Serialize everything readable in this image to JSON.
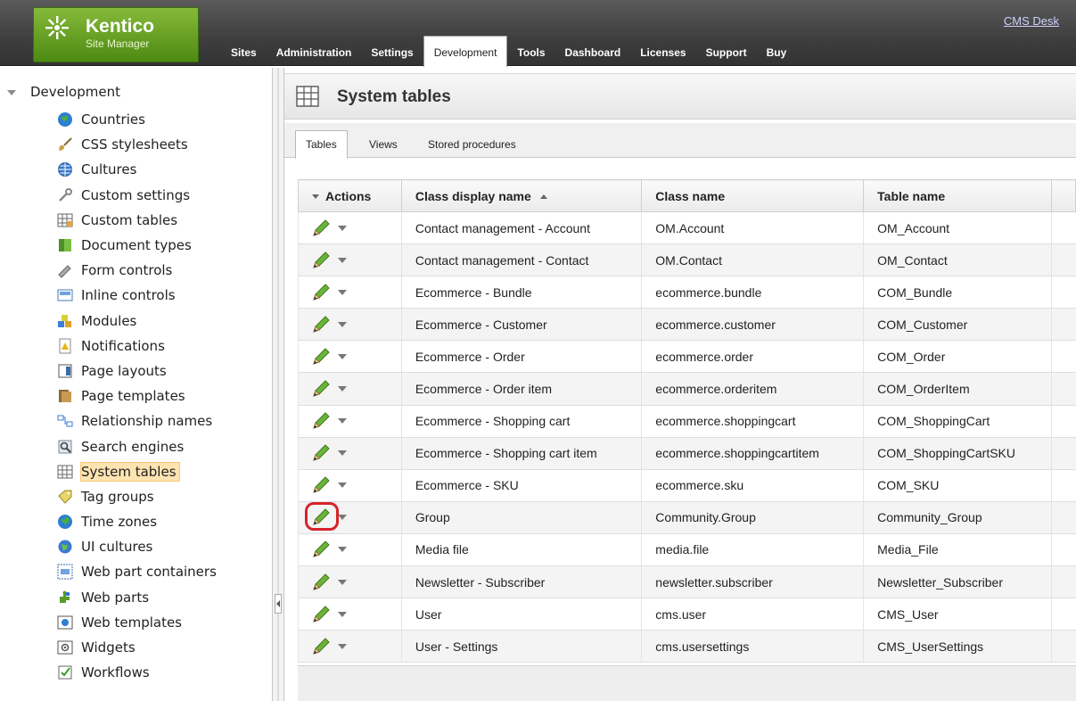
{
  "header": {
    "logo_brand": "Kentico",
    "logo_sub": "Site Manager",
    "cms_desk_link": "CMS Desk",
    "tabs": [
      {
        "label": "Sites"
      },
      {
        "label": "Administration"
      },
      {
        "label": "Settings"
      },
      {
        "label": "Development",
        "active": true
      },
      {
        "label": "Tools"
      },
      {
        "label": "Dashboard"
      },
      {
        "label": "Licenses"
      },
      {
        "label": "Support"
      },
      {
        "label": "Buy"
      }
    ]
  },
  "sidebar": {
    "root_label": "Development",
    "items": [
      {
        "label": "Countries",
        "icon": "globe-icon"
      },
      {
        "label": "CSS stylesheets",
        "icon": "brush-icon"
      },
      {
        "label": "Cultures",
        "icon": "culture-globe-icon"
      },
      {
        "label": "Custom settings",
        "icon": "wrench-icon"
      },
      {
        "label": "Custom tables",
        "icon": "table-grid-icon"
      },
      {
        "label": "Document types",
        "icon": "document-type-icon"
      },
      {
        "label": "Form controls",
        "icon": "form-control-icon"
      },
      {
        "label": "Inline controls",
        "icon": "inline-control-icon"
      },
      {
        "label": "Modules",
        "icon": "modules-icon"
      },
      {
        "label": "Notifications",
        "icon": "notification-icon"
      },
      {
        "label": "Page layouts",
        "icon": "page-layout-icon"
      },
      {
        "label": "Page templates",
        "icon": "page-template-icon"
      },
      {
        "label": "Relationship names",
        "icon": "relationship-icon"
      },
      {
        "label": "Search engines",
        "icon": "search-engine-icon"
      },
      {
        "label": "System tables",
        "icon": "system-table-icon",
        "selected": true
      },
      {
        "label": "Tag groups",
        "icon": "tag-icon"
      },
      {
        "label": "Time zones",
        "icon": "clock-globe-icon"
      },
      {
        "label": "UI cultures",
        "icon": "ui-culture-icon"
      },
      {
        "label": "Web part containers",
        "icon": "container-icon"
      },
      {
        "label": "Web parts",
        "icon": "puzzle-icon"
      },
      {
        "label": "Web templates",
        "icon": "web-template-icon"
      },
      {
        "label": "Widgets",
        "icon": "widget-icon"
      },
      {
        "label": "Workflows",
        "icon": "workflow-check-icon"
      }
    ]
  },
  "main": {
    "title": "System tables",
    "tabs": [
      {
        "label": "Tables",
        "active": true
      },
      {
        "label": "Views"
      },
      {
        "label": "Stored procedures"
      }
    ],
    "grid": {
      "columns": [
        "Actions",
        "Class display name",
        "Class name",
        "Table name"
      ],
      "rows": [
        {
          "display": "Contact management - Account",
          "class": "OM.Account",
          "table": "OM_Account"
        },
        {
          "display": "Contact management - Contact",
          "class": "OM.Contact",
          "table": "OM_Contact"
        },
        {
          "display": "Ecommerce - Bundle",
          "class": "ecommerce.bundle",
          "table": "COM_Bundle"
        },
        {
          "display": "Ecommerce - Customer",
          "class": "ecommerce.customer",
          "table": "COM_Customer"
        },
        {
          "display": "Ecommerce - Order",
          "class": "ecommerce.order",
          "table": "COM_Order"
        },
        {
          "display": "Ecommerce - Order item",
          "class": "ecommerce.orderitem",
          "table": "COM_OrderItem"
        },
        {
          "display": "Ecommerce - Shopping cart",
          "class": "ecommerce.shoppingcart",
          "table": "COM_ShoppingCart"
        },
        {
          "display": "Ecommerce - Shopping cart item",
          "class": "ecommerce.shoppingcartitem",
          "table": "COM_ShoppingCartSKU"
        },
        {
          "display": "Ecommerce - SKU",
          "class": "ecommerce.sku",
          "table": "COM_SKU"
        },
        {
          "display": "Group",
          "class": "Community.Group",
          "table": "Community_Group",
          "highlighted": true
        },
        {
          "display": "Media file",
          "class": "media.file",
          "table": "Media_File"
        },
        {
          "display": "Newsletter - Subscriber",
          "class": "newsletter.subscriber",
          "table": "Newsletter_Subscriber"
        },
        {
          "display": "User",
          "class": "cms.user",
          "table": "CMS_User"
        },
        {
          "display": "User - Settings",
          "class": "cms.usersettings",
          "table": "CMS_UserSettings"
        }
      ]
    }
  },
  "colors": {
    "logo_green": "#6aa32a",
    "header_dark": "#3e3e3e",
    "selected_item": "#fde3b0",
    "highlight_red": "#d8222a"
  }
}
